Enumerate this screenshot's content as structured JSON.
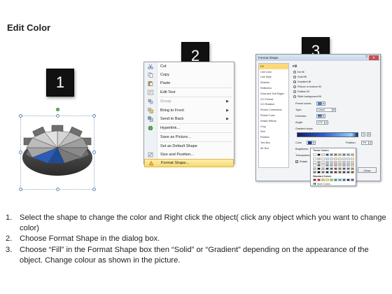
{
  "page": {
    "title": "Edit Color"
  },
  "steps": [
    {
      "number": "1"
    },
    {
      "number": "2"
    },
    {
      "number": "3"
    }
  ],
  "context_menu": {
    "items": [
      {
        "label": "Cut",
        "icon": "scissors-icon",
        "submenu": false
      },
      {
        "label": "Copy",
        "icon": "copy-icon",
        "submenu": false
      },
      {
        "label": "Paste",
        "icon": "paste-icon",
        "submenu": false
      },
      {
        "label": "Edit Text",
        "icon": "edit-text-icon",
        "submenu": false
      },
      {
        "label": "Group",
        "icon": "group-icon",
        "submenu": true
      },
      {
        "label": "Bring to Front",
        "icon": "bring-front-icon",
        "submenu": true
      },
      {
        "label": "Send to Back",
        "icon": "send-back-icon",
        "submenu": true
      },
      {
        "label": "Hyperlink...",
        "icon": "hyperlink-icon",
        "submenu": false
      },
      {
        "label": "Save as Picture...",
        "icon": "",
        "submenu": false
      },
      {
        "label": "Set as Default Shape",
        "icon": "",
        "submenu": false
      },
      {
        "label": "Size and Position...",
        "icon": "size-position-icon",
        "submenu": false
      },
      {
        "label": "Format Shape...",
        "icon": "format-shape-icon",
        "submenu": false,
        "highlighted": true
      }
    ]
  },
  "format_dialog": {
    "title": "Format Shape",
    "close_label": "Close",
    "help_label": "?",
    "nav_items": [
      "Fill",
      "Line Color",
      "Line Style",
      "Shadow",
      "Reflection",
      "Glow and Soft Edges",
      "3-D Format",
      "3-D Rotation",
      "Picture Corrections",
      "Picture Color",
      "Artistic Effects",
      "Crop",
      "Size",
      "Position",
      "Text Box",
      "Alt Text"
    ],
    "active_nav": "Fill",
    "section_title": "Fill",
    "fill_options": [
      {
        "label": "No fill",
        "selected": false
      },
      {
        "label": "Solid fill",
        "selected": false
      },
      {
        "label": "Gradient fill",
        "selected": true
      },
      {
        "label": "Picture or texture fill",
        "selected": false
      },
      {
        "label": "Pattern fill",
        "selected": false
      },
      {
        "label": "Slide background fill",
        "selected": false
      }
    ],
    "preset_label": "Preset colors:",
    "type_label": "Type:",
    "type_value": "Linear",
    "direction_label": "Direction:",
    "angle_label": "Angle:",
    "angle_value": "270°",
    "gradient_stops_label": "Gradient stops",
    "color_label": "Color",
    "position_label": "Position:",
    "position_value": "0%",
    "brightness_label": "Brightness:",
    "transparency_label": "Transparency:",
    "rotate_label": "Rotate",
    "popup": {
      "theme_colors_label": "Theme Colors",
      "standard_colors_label": "Standard Colors",
      "more_colors_label": "More Colors...",
      "theme_top": [
        "#ffffff",
        "#000000",
        "#eeece1",
        "#1f497d",
        "#4f81bd",
        "#c0504d",
        "#9bbb59",
        "#8064a2",
        "#4bacc6",
        "#f79646"
      ],
      "standard": [
        "#c00000",
        "#ff0000",
        "#ffc000",
        "#ffff00",
        "#92d050",
        "#00b050",
        "#00b0f0",
        "#0070c0",
        "#002060",
        "#7030a0"
      ]
    }
  },
  "instructions": [
    {
      "num": "1.",
      "text": "Select the shape to change the color and Right click the object( click any object which you want to change color)"
    },
    {
      "num": "2.",
      "text": "Choose Format Shape in the dialog box."
    },
    {
      "num": "3.",
      "text": "Choose “Fill” in the Format Shape box then “Solid” or “Gradient” depending on the appearance of the object. Change colour as shown in the picture."
    }
  ]
}
